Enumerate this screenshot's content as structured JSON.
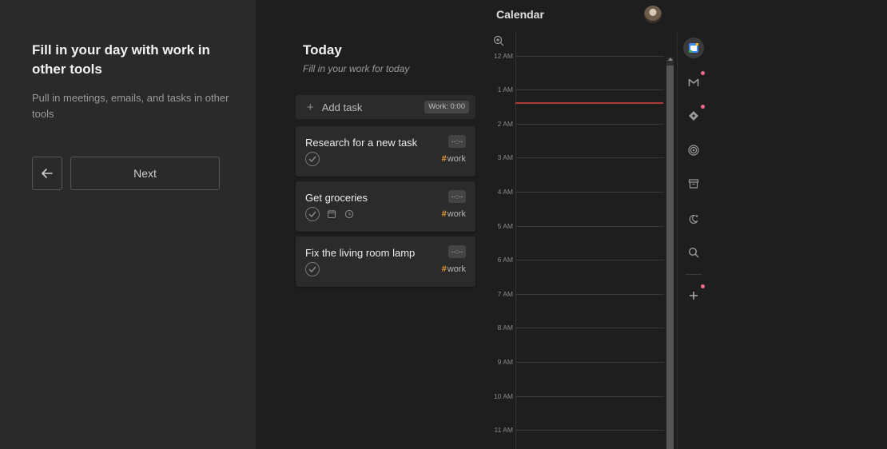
{
  "onboarding": {
    "heading": "Fill in your day with work in other tools",
    "description": "Pull in meetings, emails, and tasks in other tools",
    "back_icon": "arrow-left-icon",
    "next_label": "Next"
  },
  "today": {
    "title": "Today",
    "subtitle": "Fill in your work for today",
    "add_task_label": "Add task",
    "work_badge": "Work: 0:00",
    "tasks": [
      {
        "title": "Research for a new task",
        "duration": "--:--",
        "tag": "work",
        "icons": [
          "check-circle-icon"
        ]
      },
      {
        "title": "Get groceries",
        "duration": "--:--",
        "tag": "work",
        "icons": [
          "check-circle-icon",
          "calendar-icon",
          "clock-icon"
        ]
      },
      {
        "title": "Fix the living room lamp",
        "duration": "--:--",
        "tag": "work",
        "icons": [
          "check-circle-icon"
        ]
      }
    ]
  },
  "calendar": {
    "title": "Calendar",
    "hours": [
      "12 AM",
      "1 AM",
      "2 AM",
      "3 AM",
      "4 AM",
      "5 AM",
      "6 AM",
      "7 AM",
      "8 AM",
      "9 AM",
      "10 AM",
      "11 AM"
    ],
    "current_time_color": "#b03a3a"
  },
  "rail": {
    "items": [
      {
        "name": "google-calendar-icon",
        "active": true,
        "notification": false
      },
      {
        "name": "gmail-icon",
        "active": false,
        "notification": true
      },
      {
        "name": "diamond-integration-icon",
        "active": false,
        "notification": true
      },
      {
        "name": "target-icon",
        "active": false,
        "notification": false
      },
      {
        "name": "archive-icon",
        "active": false,
        "notification": false
      },
      {
        "name": "moon-plus-icon",
        "active": false,
        "notification": false
      },
      {
        "name": "search-icon",
        "active": false,
        "notification": false
      },
      {
        "name": "add-icon",
        "active": false,
        "notification": true
      }
    ]
  },
  "colors": {
    "tag_hash": "#e79a2c",
    "notification_dot": "#f06a8a",
    "background": "#1e1e1e",
    "panel": "#2a2a2a"
  }
}
